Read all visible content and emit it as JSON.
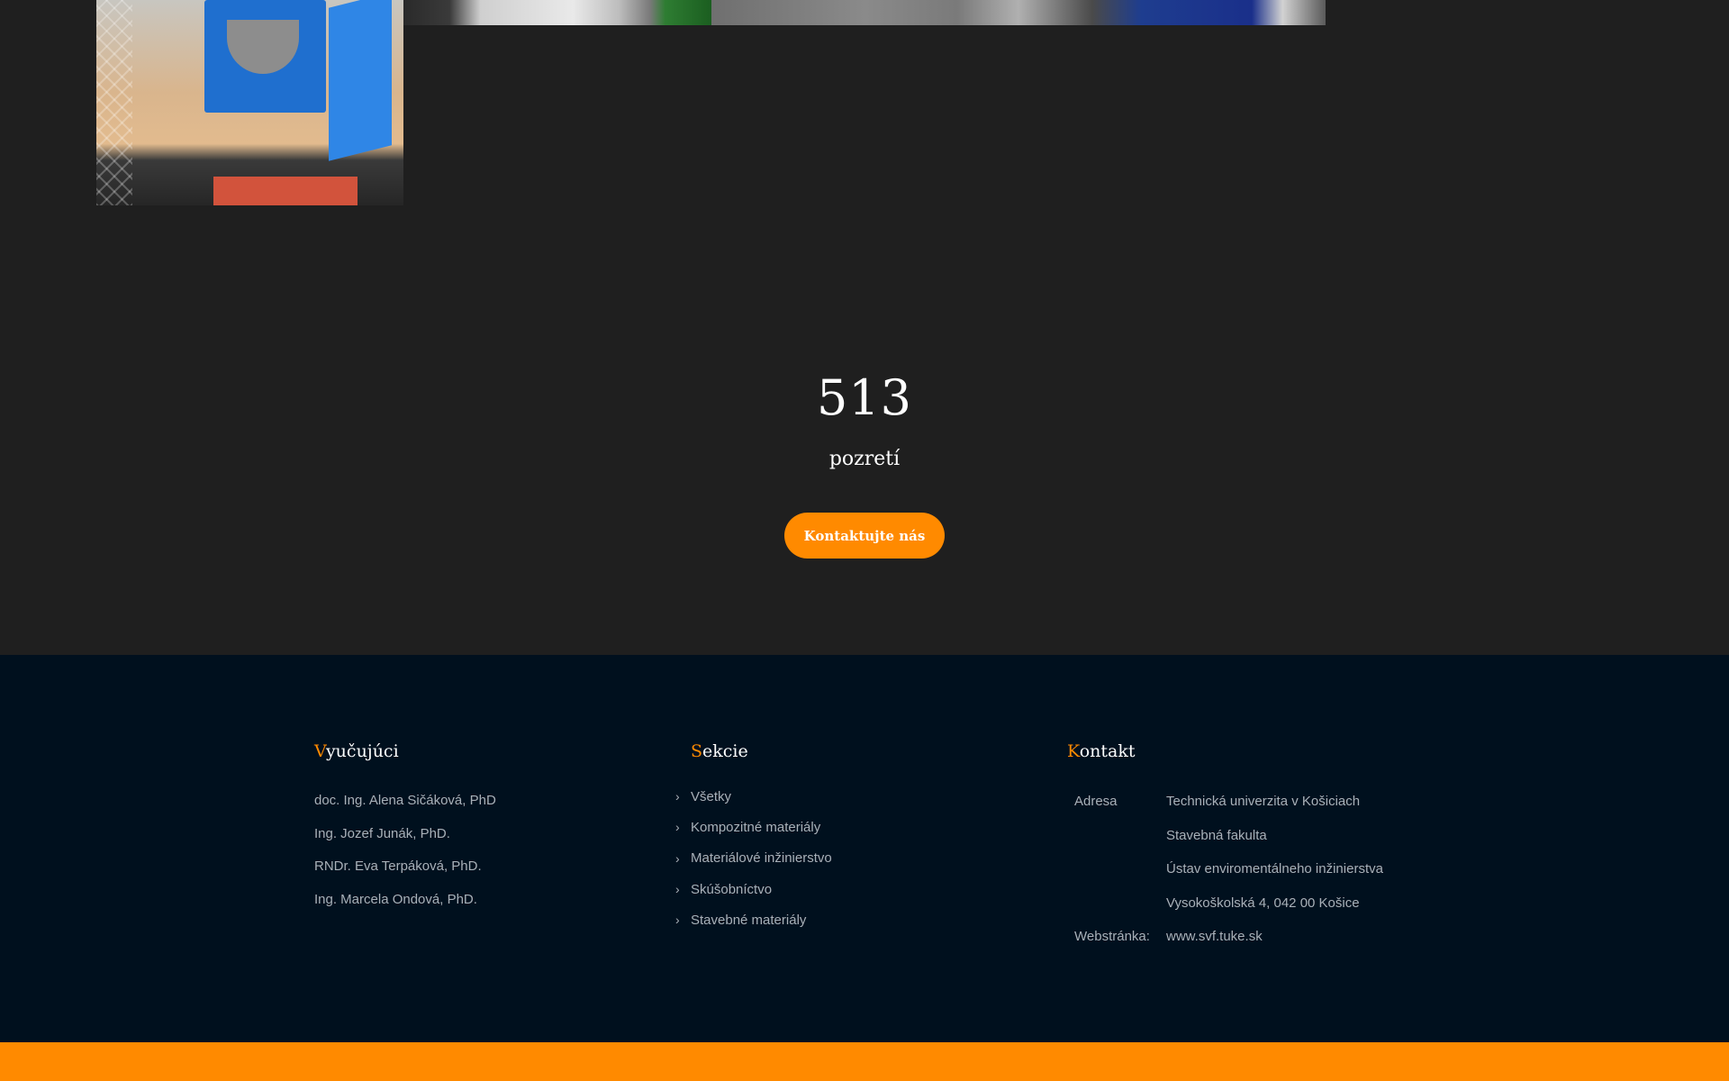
{
  "counter": {
    "number": "513",
    "label": "pozretí",
    "button_label": "Kontaktujte nás"
  },
  "footer": {
    "teachers": {
      "title_first": "V",
      "title_rest": "yučujúci",
      "items": [
        "doc. Ing. Alena Sičáková, PhD",
        "Ing. Jozef Junák, PhD.",
        "RNDr. Eva Terpáková, PhD.",
        "Ing. Marcela Ondová, PhD."
      ]
    },
    "sections": {
      "title_first": "S",
      "title_rest": "ekcie",
      "items": [
        "Všetky",
        "Kompozitné materiály",
        "Materiálové inžinierstvo",
        "Skúšobníctvo",
        "Stavebné materiály"
      ]
    },
    "contact": {
      "title_first": "K",
      "title_rest": "ontakt",
      "address_label": "Adresa",
      "address_lines": [
        "Technická univerzita v Košiciach",
        "Stavebná fakulta",
        "Ústav enviromentálneho inžinierstva",
        "Vysokoškolská 4, 042 00 Košice"
      ],
      "web_label": "Webstránka:",
      "web_value": "www.svf.tuke.sk"
    }
  },
  "colors": {
    "accent": "#ff8a00",
    "page_bg": "#1f1f1f",
    "footer_bg": "#00101e"
  }
}
